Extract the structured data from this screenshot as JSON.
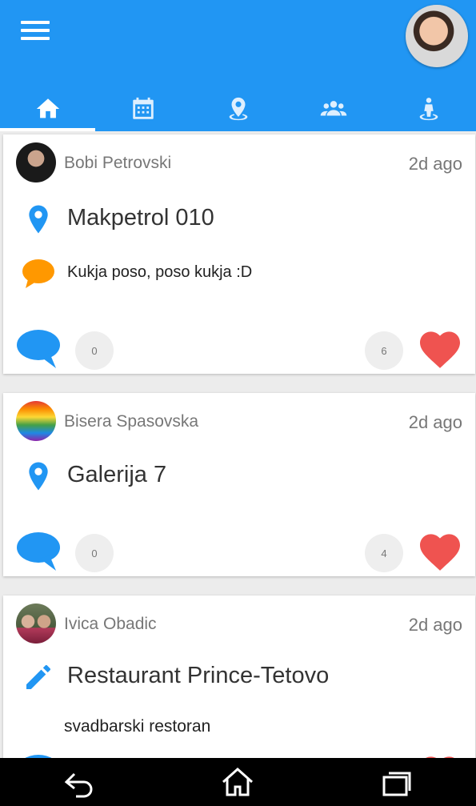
{
  "tabs": [
    {
      "icon": "home-icon"
    },
    {
      "icon": "calendar-icon"
    },
    {
      "icon": "location-pin-icon"
    },
    {
      "icon": "group-icon"
    },
    {
      "icon": "person-pin-icon"
    }
  ],
  "posts": [
    {
      "user": "Bobi Petrovski",
      "time": "2d ago",
      "place_icon": "map-marker-icon",
      "place": "Makpetrol 010",
      "comment": "Kukja poso, poso kukja :D",
      "comments": "0",
      "likes": "6"
    },
    {
      "user": "Bisera Spasovska",
      "time": "2d ago",
      "place_icon": "map-marker-icon",
      "place": "Galerija 7",
      "comment": "",
      "comments": "0",
      "likes": "4"
    },
    {
      "user": "Ivica Obadic",
      "time": "2d ago",
      "place_icon": "pencil-icon",
      "place": "Restaurant Prince-Tetovo",
      "description": "svadbarski restoran"
    }
  ],
  "colors": {
    "primary": "#2196f3",
    "heart": "#ef5350",
    "comment": "#ff9800"
  }
}
